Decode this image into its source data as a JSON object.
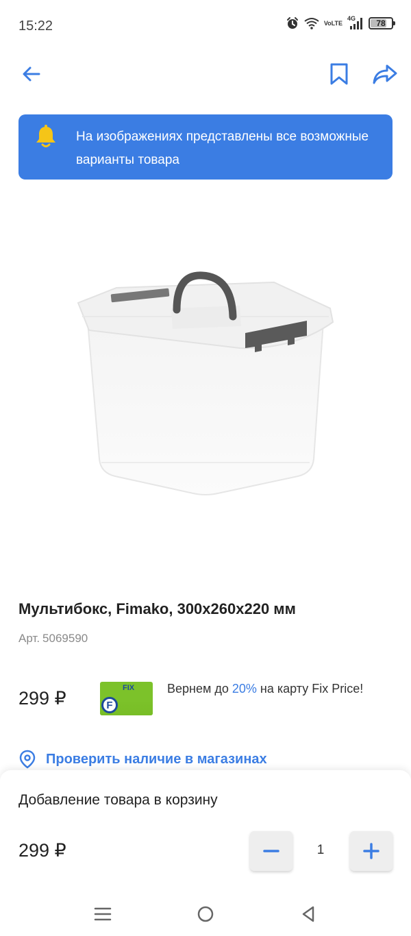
{
  "status_bar": {
    "time": "15:22",
    "icons": [
      "alarm-icon",
      "wifi-icon",
      "volte-icon",
      "signal-4g-icon",
      "battery-icon"
    ],
    "volte_top": "Vo",
    "volte_bottom": "LTE",
    "network": "4G",
    "battery_level": "78",
    "battery_fraction": 0.78
  },
  "nav": {
    "icons": [
      "back-arrow-icon",
      "bookmark-icon",
      "share-icon"
    ]
  },
  "banner": {
    "icon": "bell-icon",
    "text": "На изображениях представлены все возможные варианты товара",
    "color": "#3b7de3"
  },
  "product": {
    "title": "Мультибокс, Fimako, 300x260x220 мм",
    "article_label": "Арт.",
    "article_number": "5069590",
    "price": "299 ₽",
    "card_logo": "FIX",
    "card_letter": "F",
    "cashback_prefix": "Вернем до ",
    "cashback_percent": "20%",
    "cashback_suffix": " на карту Fix Price!",
    "check_stores": "Проверить наличие в магазинах"
  },
  "cart_sheet": {
    "title": "Добавление товара в корзину",
    "price": "299 ₽",
    "quantity": "1"
  },
  "android_nav": {
    "icons": [
      "menu-icon",
      "home-icon",
      "back-triangle-icon"
    ]
  },
  "colors": {
    "accent": "#3b7de3",
    "bell": "#f5c518",
    "card_green": "#7cc22a"
  }
}
